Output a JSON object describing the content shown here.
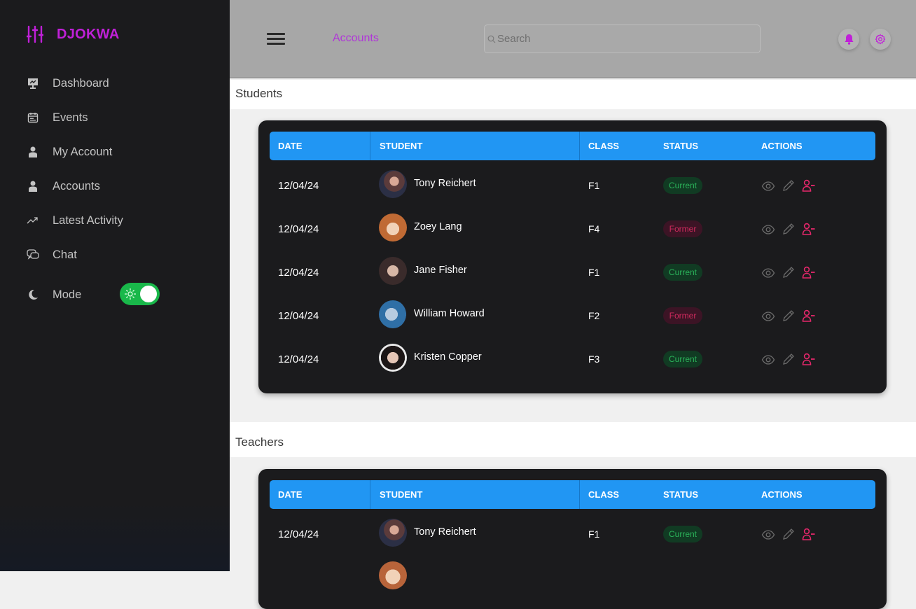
{
  "app": {
    "name": "DJOKWA",
    "brand_color": "#c020d8"
  },
  "sidebar": {
    "items": [
      {
        "label": "Dashboard",
        "icon": "presentation-icon"
      },
      {
        "label": "Events",
        "icon": "calendar-icon"
      },
      {
        "label": "My Account",
        "icon": "user-icon"
      },
      {
        "label": "Accounts",
        "icon": "user-icon"
      },
      {
        "label": "Latest Activity",
        "icon": "trend-icon"
      },
      {
        "label": "Chat",
        "icon": "chat-icon"
      }
    ],
    "mode": {
      "label": "Mode",
      "toggle_on": true,
      "toggle_color": "#19b84a"
    }
  },
  "topbar": {
    "breadcrumb": "Accounts",
    "search_placeholder": "Search",
    "accent_color": "#b035d8"
  },
  "headers": {
    "date": "DATE",
    "student": "STUDENT",
    "class": "CLASS",
    "status": "STATUS",
    "actions": "ACTIONS"
  },
  "students": {
    "title": "Students",
    "rows": [
      {
        "date": "12/04/24",
        "name": "Tony Reichert",
        "class": "F1",
        "status": "Current"
      },
      {
        "date": "12/04/24",
        "name": "Zoey Lang",
        "class": "F4",
        "status": "Former"
      },
      {
        "date": "12/04/24",
        "name": "Jane Fisher",
        "class": "F1",
        "status": "Current"
      },
      {
        "date": "12/04/24",
        "name": "William Howard",
        "class": "F2",
        "status": "Former"
      },
      {
        "date": "12/04/24",
        "name": "Kristen Copper",
        "class": "F3",
        "status": "Current"
      }
    ]
  },
  "teachers": {
    "title": "Teachers",
    "rows": [
      {
        "date": "12/04/24",
        "name": "Tony Reichert",
        "class": "F1",
        "status": "Current"
      }
    ]
  },
  "colors": {
    "header_blue": "#2196f3",
    "current_green": "#2bb35a",
    "former_red": "#d12a5e",
    "action_pink": "#e5276b"
  }
}
